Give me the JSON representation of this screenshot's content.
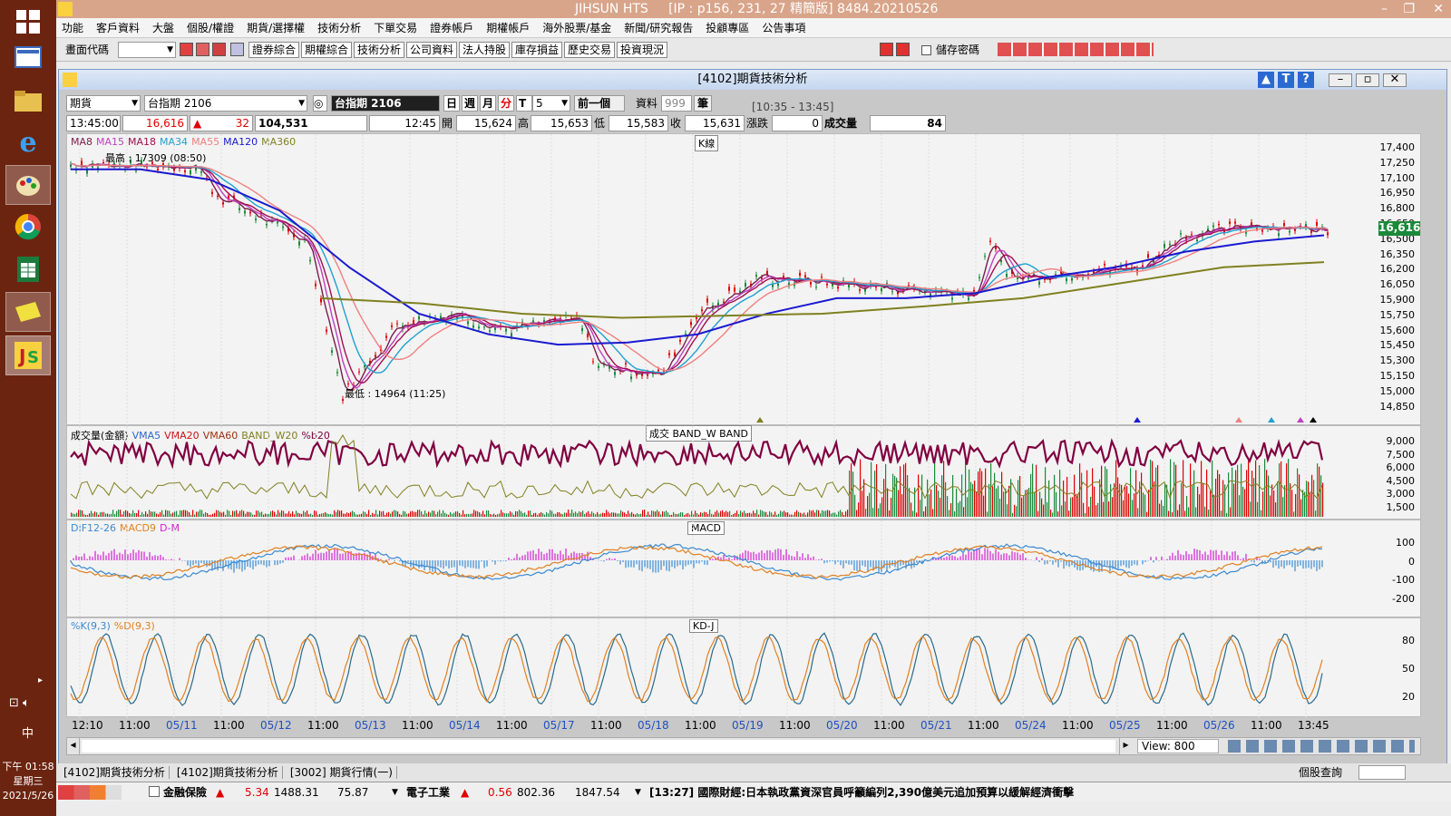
{
  "taskbar": {
    "time": "下午 01:58",
    "weekday": "星期三",
    "date": "2021/5/26",
    "ime": "中"
  },
  "window": {
    "title": "JIHSUN HTS",
    "subtitle": "[IP : p156, 231, 27 精簡版] 8484.20210526"
  },
  "menu": [
    "功能",
    "客戶資料",
    "大盤",
    "個股/權證",
    "期貨/選擇權",
    "技術分析",
    "下單交易",
    "證券帳戶",
    "期權帳戶",
    "海外股票/基金",
    "新聞/研究報告",
    "投顧專區",
    "公告事項"
  ],
  "toolbar": {
    "screen_code_label": "畫面代碼",
    "buttons": [
      "證券綜合",
      "期權綜合",
      "技術分析",
      "公司資料",
      "法人持股",
      "庫存損益",
      "歷史交易",
      "投資現況"
    ],
    "save_pw": "儲存密碼"
  },
  "inner": {
    "title": "[4102]期貨技術分析"
  },
  "controls": {
    "type": "期貨",
    "symbol": "台指期 2106",
    "symbol_display": "台指期 2106",
    "periods": [
      "日",
      "週",
      "月",
      "分",
      "T"
    ],
    "interval": "5",
    "prev": "前一個",
    "data_label": "資料",
    "data_count": "999",
    "unit": "筆",
    "range": "[10:35 - 13:45]"
  },
  "quote": {
    "time": "13:45:00",
    "price": "16,616",
    "change": "32",
    "volume": "104,531",
    "t2": "12:45",
    "open_l": "開",
    "open": "15,624",
    "high_l": "高",
    "high": "15,653",
    "low_l": "低",
    "low": "15,583",
    "close_l": "收",
    "close": "15,631",
    "chg_l": "漲跌",
    "chg": "0",
    "vol_l": "成交量",
    "vol": "84"
  },
  "kpanel": {
    "title": "K線",
    "legend": [
      {
        "t": "MA8",
        "c": "#7a1d4a"
      },
      {
        "t": "MA15",
        "c": "#c040c0"
      },
      {
        "t": "MA18",
        "c": "#a01050"
      },
      {
        "t": "MA34",
        "c": "#20a0d0"
      },
      {
        "t": "MA55",
        "c": "#f08080"
      },
      {
        "t": "MA120",
        "c": "#1a1ad0"
      },
      {
        "t": "MA360",
        "c": "#808020"
      }
    ],
    "high_label": "最高 : 17309 (08:50)",
    "low_label": "最低 : 14964 (11:25)",
    "yticks": [
      "17,400",
      "17,250",
      "17,100",
      "16,950",
      "16,800",
      "16,650",
      "16,500",
      "16,350",
      "16,200",
      "16,050",
      "15,900",
      "15,750",
      "15,600",
      "15,450",
      "15,300",
      "15,150",
      "15,000",
      "14,850"
    ],
    "last": "16,616"
  },
  "volpanel": {
    "title": "成交  BAND_W  BAND",
    "legend": [
      {
        "t": "成交量(金額)",
        "c": "#000"
      },
      {
        "t": "VMA5",
        "c": "#2a6ad0"
      },
      {
        "t": "VMA20",
        "c": "#d01010"
      },
      {
        "t": "VMA60",
        "c": "#a03010"
      },
      {
        "t": "BAND_W20",
        "c": "#808020"
      },
      {
        "t": "%b20",
        "c": "#800040"
      }
    ],
    "yticks": [
      "9,000",
      "7,500",
      "6,000",
      "4,500",
      "3,000",
      "1,500"
    ]
  },
  "macdpanel": {
    "title": "MACD",
    "legend": [
      {
        "t": "DIF12-26",
        "c": "#3a8ad0"
      },
      {
        "t": "MACD9",
        "c": "#e08020"
      },
      {
        "t": "D-M",
        "c": "#d020d0"
      }
    ],
    "yticks": [
      "100",
      "0",
      "-100",
      "-200"
    ]
  },
  "kdpanel": {
    "title": "KD-J",
    "legend": [
      {
        "t": "%K(9,3)",
        "c": "#3a8ad0"
      },
      {
        "t": "%D(9,3)",
        "c": "#e08020"
      }
    ],
    "yticks": [
      "80",
      "50",
      "20"
    ]
  },
  "xaxis": [
    "12:10",
    "11:00",
    "05/11",
    "11:00",
    "05/12",
    "11:00",
    "05/13",
    "11:00",
    "05/14",
    "11:00",
    "05/17",
    "11:00",
    "05/18",
    "11:00",
    "05/19",
    "11:00",
    "05/20",
    "11:00",
    "05/21",
    "11:00",
    "05/24",
    "11:00",
    "05/25",
    "11:00",
    "05/26",
    "11:00",
    "13:45"
  ],
  "view": "View: 800",
  "tabs": [
    "[4102]期貨技術分析",
    "[4102]期貨技術分析",
    "[3002]  期貨行情(一)"
  ],
  "tab_right": "個股查詢",
  "status": {
    "s1": "金融保險",
    "s1v": "5.34",
    "s1a": "1488.31",
    "s1b": "75.87",
    "s2": "電子工業",
    "s2v": "0.56",
    "s2a": "802.36",
    "s2b": "1847.54",
    "news": "[13:27] 國際財經:日本執政黨資深官員呼籲編列2,390億美元追加預算以緩解經濟衝擊"
  },
  "colors": {
    "taskbar": "#6b2410",
    "up": "#e00000",
    "ma120": "#1a1ad0",
    "ma360": "#808020"
  },
  "chart_data": {
    "type": "line",
    "title": "K線",
    "series": [
      {
        "name": "MA120",
        "values": [
          17200,
          17200,
          17100,
          16800,
          16250,
          15800,
          15600,
          15500,
          15520,
          15600,
          15800,
          15950,
          15950,
          16000,
          16150,
          16250,
          16400,
          16500,
          16560
        ]
      },
      {
        "name": "MA360",
        "values": [
          15950,
          15900,
          15800,
          15760,
          15780,
          15800,
          15870,
          15950,
          16100,
          16250,
          16300
        ]
      }
    ],
    "ylim": [
      14850,
      17400
    ]
  }
}
